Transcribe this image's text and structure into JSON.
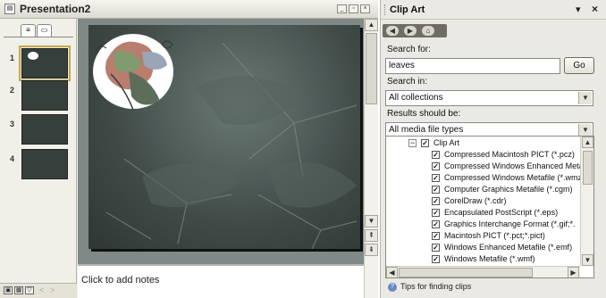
{
  "presentation": {
    "window_title": "Presentation2",
    "window_buttons": [
      "_",
      "□",
      "x"
    ],
    "thumbnail_tabs": [
      "outline",
      "slides"
    ],
    "slides": [
      {
        "number": "1",
        "selected": true
      },
      {
        "number": "2",
        "selected": false
      },
      {
        "number": "3",
        "selected": false
      },
      {
        "number": "4",
        "selected": false
      }
    ],
    "notes_placeholder": "Click to add notes"
  },
  "clip_art": {
    "title": "Clip Art",
    "search_for_label": "Search for:",
    "search_value": "leaves",
    "go_label": "Go",
    "search_in_label": "Search in:",
    "search_in_value": "All collections",
    "results_label": "Results should be:",
    "results_value": "All media file types",
    "tree": {
      "root": "Clip Art",
      "items": [
        "Compressed Macintosh PICT (*.pcz)",
        "Compressed Windows Enhanced Meta",
        "Compressed Windows Metafile (*.wmz",
        "Computer Graphics Metafile (*.cgm)",
        "CorelDraw (*.cdr)",
        "Encapsulated PostScript (*.eps)",
        "Graphics Interchange Format (*.gif;*.",
        "Macintosh PICT (*.pct;*.pict)",
        "Windows Enhanced Metafile (*.emf)",
        "Windows Metafile (*.wmf)"
      ]
    },
    "tips_label": "Tips for finding clips"
  }
}
